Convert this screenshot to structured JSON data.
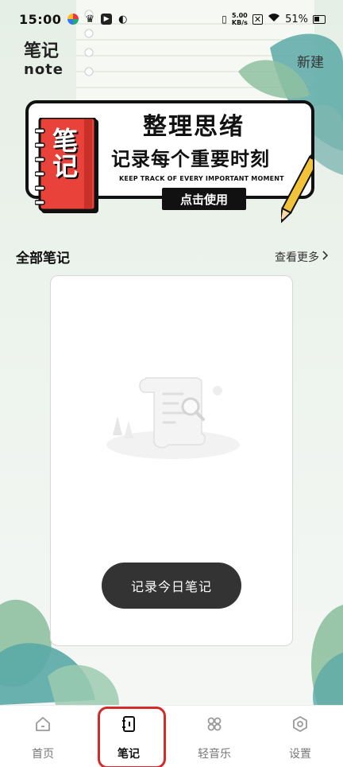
{
  "status_bar": {
    "time": "15:00",
    "net_speed_value": "5.00",
    "net_speed_unit": "KB/s",
    "battery": "51%"
  },
  "header": {
    "title": "笔记",
    "subtitle": "note",
    "new_label": "新建"
  },
  "banner": {
    "notebook_label": "笔记",
    "title": "整理思绪",
    "subtitle": "记录每个重要时刻",
    "english": "KEEP TRACK OF EVERY IMPORTANT MOMENT",
    "cta": "点击使用"
  },
  "section": {
    "title": "全部笔记",
    "more_label": "查看更多"
  },
  "card": {
    "record_button": "记录今日笔记"
  },
  "tabbar": {
    "items": [
      {
        "label": "首页",
        "icon": "home-icon"
      },
      {
        "label": "笔记",
        "icon": "notebook-icon"
      },
      {
        "label": "轻音乐",
        "icon": "music-grid-icon"
      },
      {
        "label": "设置",
        "icon": "settings-icon"
      }
    ],
    "active_index": 1
  },
  "colors": {
    "background": "#eef4ee",
    "leaf_teal": "#5aa9a6",
    "leaf_green": "#8fc1a0",
    "notebook_red": "#e8423a",
    "pencil_yellow": "#f2c23a",
    "highlight_red": "#d42a2a"
  }
}
